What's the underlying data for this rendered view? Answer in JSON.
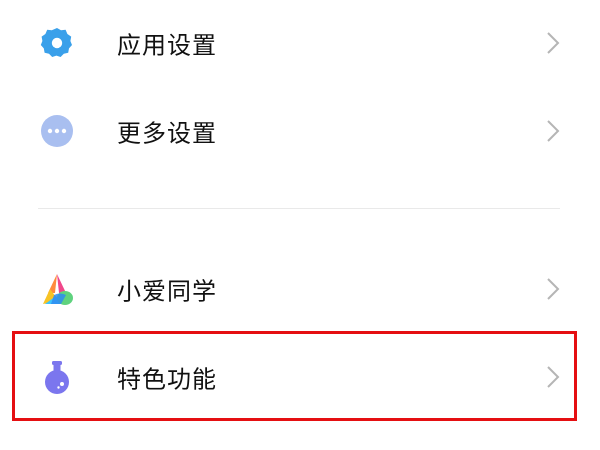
{
  "settings": {
    "items": [
      {
        "label": "应用设置",
        "icon": "gear-icon"
      },
      {
        "label": "更多设置",
        "icon": "more-dots-icon"
      },
      {
        "label": "小爱同学",
        "icon": "xiaoai-assistant-icon"
      },
      {
        "label": "特色功能",
        "icon": "flask-icon"
      }
    ]
  },
  "colors": {
    "gear": "#3aa0ea",
    "more": "#a9bff0",
    "flask": "#7b76ee",
    "highlight_border": "#e50f12",
    "chevron": "#b5b5b5"
  }
}
